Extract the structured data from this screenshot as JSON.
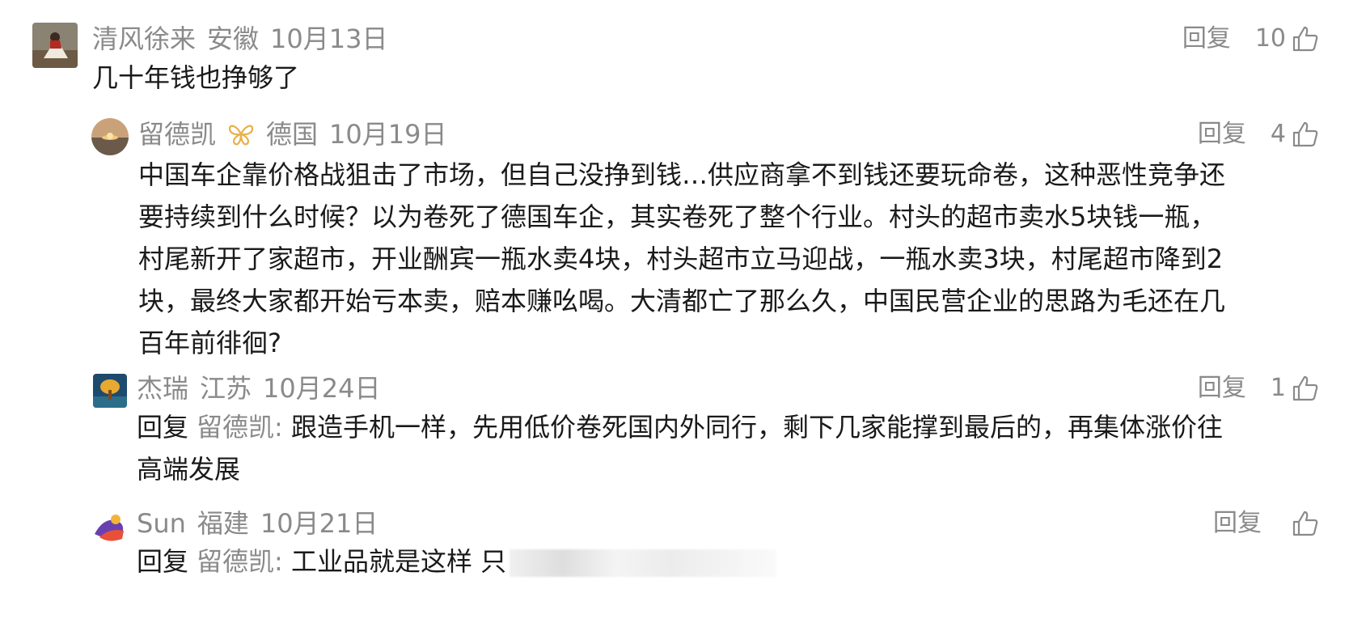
{
  "comments": [
    {
      "name": "清风徐来",
      "location": "安徽",
      "date": "10月13日",
      "reply_label": "回复",
      "likes": "10",
      "text": "几十年钱也挣够了"
    },
    {
      "name": "留德凯",
      "location": "德国",
      "date": "10月19日",
      "reply_label": "回复",
      "likes": "4",
      "text": "中国车企靠价格战狙击了市场，但自己没挣到钱…供应商拿不到钱还要玩命卷，这种恶性竞争还要持续到什么时候？以为卷死了德国车企，其实卷死了整个行业。村头的超市卖水5块钱一瓶，村尾新开了家超市，开业酬宾一瓶水卖4块，村头超市立马迎战，一瓶水卖3块，村尾超市降到2块，最终大家都开始亏本卖，赔本赚吆喝。大清都亡了那么久，中国民营企业的思路为毛还在几百年前徘徊?"
    },
    {
      "name": "杰瑞",
      "location": "江苏",
      "date": "10月24日",
      "reply_label": "回复",
      "likes": "1",
      "reply_prefix": "回复",
      "reply_target": "留德凯",
      "reply_colon": ":",
      "text": "跟造手机一样，先用低价卷死国内外同行，剩下几家能撑到最后的，再集体涨价往高端发展"
    },
    {
      "name": "Sun",
      "location": "福建",
      "date": "10月21日",
      "reply_label": "回复",
      "likes": "",
      "reply_prefix": "回复",
      "reply_target": "留德凯",
      "reply_colon": ":",
      "text": "工业品就是这样 只"
    }
  ],
  "colors": {
    "meta_gray": "#8a8a8a",
    "text": "#1a1a1a",
    "badge_gold": "#e8b04a"
  },
  "icons": {
    "like": "thumbs-up-icon",
    "badge": "butterfly-badge-icon"
  }
}
